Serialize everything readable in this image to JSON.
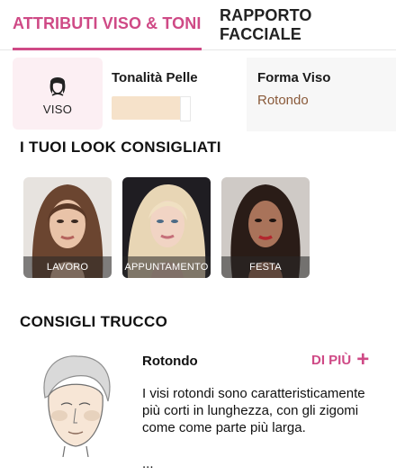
{
  "tabs": [
    {
      "label": "ATTRIBUTI VISO & TONI"
    },
    {
      "label": "RAPPORTO FACCIALE"
    }
  ],
  "attributes": {
    "viso_label": "VISO",
    "tone_title": "Tonalità Pelle",
    "tone_color": "#f6e2ca",
    "shape_title": "Forma Viso",
    "shape_value": "Rotondo"
  },
  "looks": {
    "title": "I TUOI LOOK CONSIGLIATI",
    "items": [
      {
        "label": "LAVORO"
      },
      {
        "label": "APPUNTAMENTO"
      },
      {
        "label": "FESTA"
      }
    ]
  },
  "tips": {
    "title": "CONSIGLI TRUCCO",
    "shape_name": "Rotondo",
    "more_label": "DI PIÙ",
    "more_icon": "plus-icon",
    "description": "I visi rotondi sono caratteristicamente più corti in lunghezza, con gli zigomi come come parte più larga.",
    "ellipsis": "..."
  },
  "colors": {
    "accent": "#cf4a86",
    "viso_bg": "#fceff3"
  }
}
